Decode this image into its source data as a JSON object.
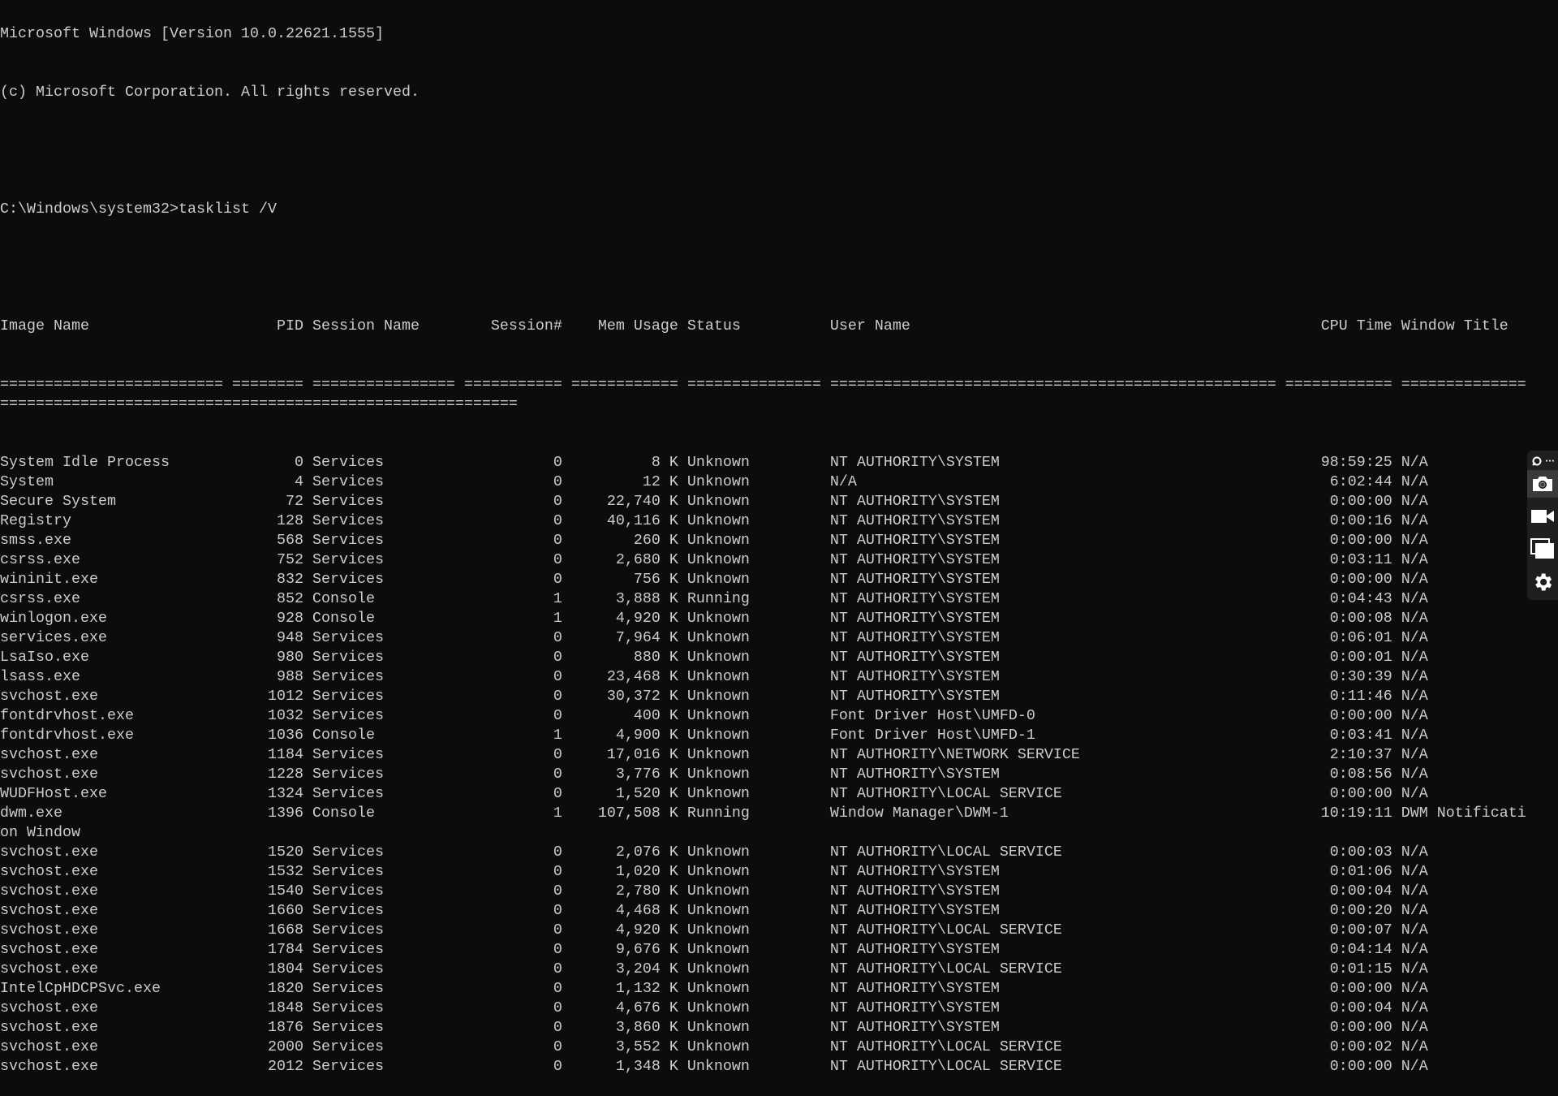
{
  "terminal": {
    "banner": "Microsoft Windows [Version 10.0.22621.1555]",
    "copyright": "(c) Microsoft Corporation. All rights reserved.",
    "prompt": "C:\\Windows\\system32>tasklist /V",
    "columns": [
      "Image Name",
      "PID",
      "Session Name",
      "Session#",
      "Mem Usage",
      "Status",
      "User Name",
      "CPU Time",
      "Window Title"
    ],
    "rows": [
      [
        "System Idle Process",
        "0",
        "Services",
        "0",
        "8 K",
        "Unknown",
        "NT AUTHORITY\\SYSTEM",
        "98:59:25",
        "N/A"
      ],
      [
        "System",
        "4",
        "Services",
        "0",
        "12 K",
        "Unknown",
        "N/A",
        "6:02:44",
        "N/A"
      ],
      [
        "Secure System",
        "72",
        "Services",
        "0",
        "22,740 K",
        "Unknown",
        "NT AUTHORITY\\SYSTEM",
        "0:00:00",
        "N/A"
      ],
      [
        "Registry",
        "128",
        "Services",
        "0",
        "40,116 K",
        "Unknown",
        "NT AUTHORITY\\SYSTEM",
        "0:00:16",
        "N/A"
      ],
      [
        "smss.exe",
        "568",
        "Services",
        "0",
        "260 K",
        "Unknown",
        "NT AUTHORITY\\SYSTEM",
        "0:00:00",
        "N/A"
      ],
      [
        "csrss.exe",
        "752",
        "Services",
        "0",
        "2,680 K",
        "Unknown",
        "NT AUTHORITY\\SYSTEM",
        "0:03:11",
        "N/A"
      ],
      [
        "wininit.exe",
        "832",
        "Services",
        "0",
        "756 K",
        "Unknown",
        "NT AUTHORITY\\SYSTEM",
        "0:00:00",
        "N/A"
      ],
      [
        "csrss.exe",
        "852",
        "Console",
        "1",
        "3,888 K",
        "Running",
        "NT AUTHORITY\\SYSTEM",
        "0:04:43",
        "N/A"
      ],
      [
        "winlogon.exe",
        "928",
        "Console",
        "1",
        "4,920 K",
        "Unknown",
        "NT AUTHORITY\\SYSTEM",
        "0:00:08",
        "N/A"
      ],
      [
        "services.exe",
        "948",
        "Services",
        "0",
        "7,964 K",
        "Unknown",
        "NT AUTHORITY\\SYSTEM",
        "0:06:01",
        "N/A"
      ],
      [
        "LsaIso.exe",
        "980",
        "Services",
        "0",
        "880 K",
        "Unknown",
        "NT AUTHORITY\\SYSTEM",
        "0:00:01",
        "N/A"
      ],
      [
        "lsass.exe",
        "988",
        "Services",
        "0",
        "23,468 K",
        "Unknown",
        "NT AUTHORITY\\SYSTEM",
        "0:30:39",
        "N/A"
      ],
      [
        "svchost.exe",
        "1012",
        "Services",
        "0",
        "30,372 K",
        "Unknown",
        "NT AUTHORITY\\SYSTEM",
        "0:11:46",
        "N/A"
      ],
      [
        "fontdrvhost.exe",
        "1032",
        "Services",
        "0",
        "400 K",
        "Unknown",
        "Font Driver Host\\UMFD-0",
        "0:00:00",
        "N/A"
      ],
      [
        "fontdrvhost.exe",
        "1036",
        "Console",
        "1",
        "4,900 K",
        "Unknown",
        "Font Driver Host\\UMFD-1",
        "0:03:41",
        "N/A"
      ],
      [
        "svchost.exe",
        "1184",
        "Services",
        "0",
        "17,016 K",
        "Unknown",
        "NT AUTHORITY\\NETWORK SERVICE",
        "2:10:37",
        "N/A"
      ],
      [
        "svchost.exe",
        "1228",
        "Services",
        "0",
        "3,776 K",
        "Unknown",
        "NT AUTHORITY\\SYSTEM",
        "0:08:56",
        "N/A"
      ],
      [
        "WUDFHost.exe",
        "1324",
        "Services",
        "0",
        "1,520 K",
        "Unknown",
        "NT AUTHORITY\\LOCAL SERVICE",
        "0:00:00",
        "N/A"
      ],
      [
        "dwm.exe",
        "1396",
        "Console",
        "1",
        "107,508 K",
        "Running",
        "Window Manager\\DWM-1",
        "10:19:11",
        "DWM Notification Window"
      ],
      [
        "svchost.exe",
        "1520",
        "Services",
        "0",
        "2,076 K",
        "Unknown",
        "NT AUTHORITY\\LOCAL SERVICE",
        "0:00:03",
        "N/A"
      ],
      [
        "svchost.exe",
        "1532",
        "Services",
        "0",
        "1,020 K",
        "Unknown",
        "NT AUTHORITY\\SYSTEM",
        "0:01:06",
        "N/A"
      ],
      [
        "svchost.exe",
        "1540",
        "Services",
        "0",
        "2,780 K",
        "Unknown",
        "NT AUTHORITY\\SYSTEM",
        "0:00:04",
        "N/A"
      ],
      [
        "svchost.exe",
        "1660",
        "Services",
        "0",
        "4,468 K",
        "Unknown",
        "NT AUTHORITY\\SYSTEM",
        "0:00:20",
        "N/A"
      ],
      [
        "svchost.exe",
        "1668",
        "Services",
        "0",
        "4,920 K",
        "Unknown",
        "NT AUTHORITY\\LOCAL SERVICE",
        "0:00:07",
        "N/A"
      ],
      [
        "svchost.exe",
        "1784",
        "Services",
        "0",
        "9,676 K",
        "Unknown",
        "NT AUTHORITY\\SYSTEM",
        "0:04:14",
        "N/A"
      ],
      [
        "svchost.exe",
        "1804",
        "Services",
        "0",
        "3,204 K",
        "Unknown",
        "NT AUTHORITY\\LOCAL SERVICE",
        "0:01:15",
        "N/A"
      ],
      [
        "IntelCpHDCPSvc.exe",
        "1820",
        "Services",
        "0",
        "1,132 K",
        "Unknown",
        "NT AUTHORITY\\SYSTEM",
        "0:00:00",
        "N/A"
      ],
      [
        "svchost.exe",
        "1848",
        "Services",
        "0",
        "4,676 K",
        "Unknown",
        "NT AUTHORITY\\SYSTEM",
        "0:00:04",
        "N/A"
      ],
      [
        "svchost.exe",
        "1876",
        "Services",
        "0",
        "3,860 K",
        "Unknown",
        "NT AUTHORITY\\SYSTEM",
        "0:00:00",
        "N/A"
      ],
      [
        "svchost.exe",
        "2000",
        "Services",
        "0",
        "3,552 K",
        "Unknown",
        "NT AUTHORITY\\LOCAL SERVICE",
        "0:00:02",
        "N/A"
      ],
      [
        "svchost.exe",
        "2012",
        "Services",
        "0",
        "1,348 K",
        "Unknown",
        "NT AUTHORITY\\LOCAL SERVICE",
        "0:00:00",
        "N/A"
      ]
    ]
  },
  "toolbar": {
    "items": [
      "pin-icon",
      "screenshot-camera-icon",
      "video-record-icon",
      "window-copy-icon",
      "settings-gear-icon"
    ],
    "more_label": "···"
  },
  "colors": {
    "background": "#0c0c0c",
    "text": "#cccccc",
    "toolbar": "#1f1f1f"
  }
}
